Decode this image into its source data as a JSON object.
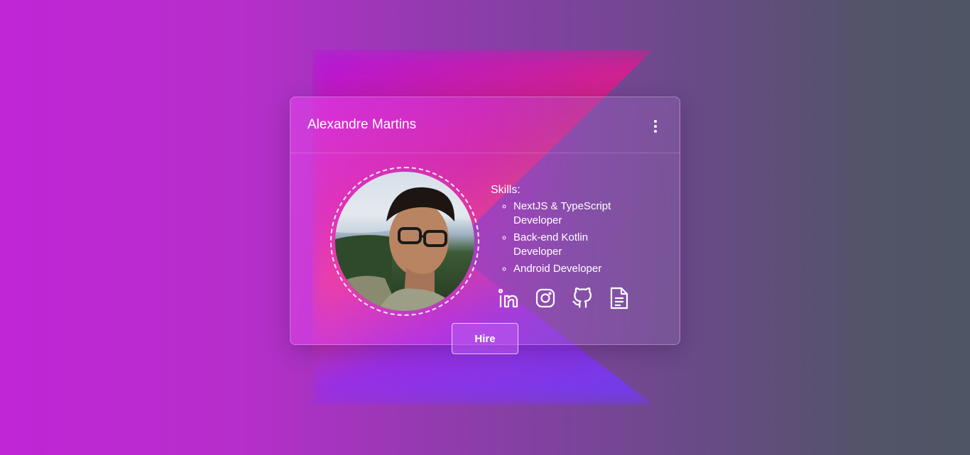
{
  "profile": {
    "name": "Alexandre Martins",
    "menu_icon": "more-vertical-icon",
    "avatar_alt": "Profile photo"
  },
  "skills": {
    "title": "Skills:",
    "items": [
      "NextJS & TypeScript Developer",
      "Back-end Kotlin Developer",
      "Android Developer"
    ]
  },
  "socials": [
    {
      "icon": "linkedin-icon"
    },
    {
      "icon": "instagram-icon"
    },
    {
      "icon": "github-icon"
    },
    {
      "icon": "document-icon"
    }
  ],
  "actions": {
    "hire_label": "Hire"
  },
  "colors": {
    "accent": "#c025d6",
    "text": "#ffffff"
  }
}
